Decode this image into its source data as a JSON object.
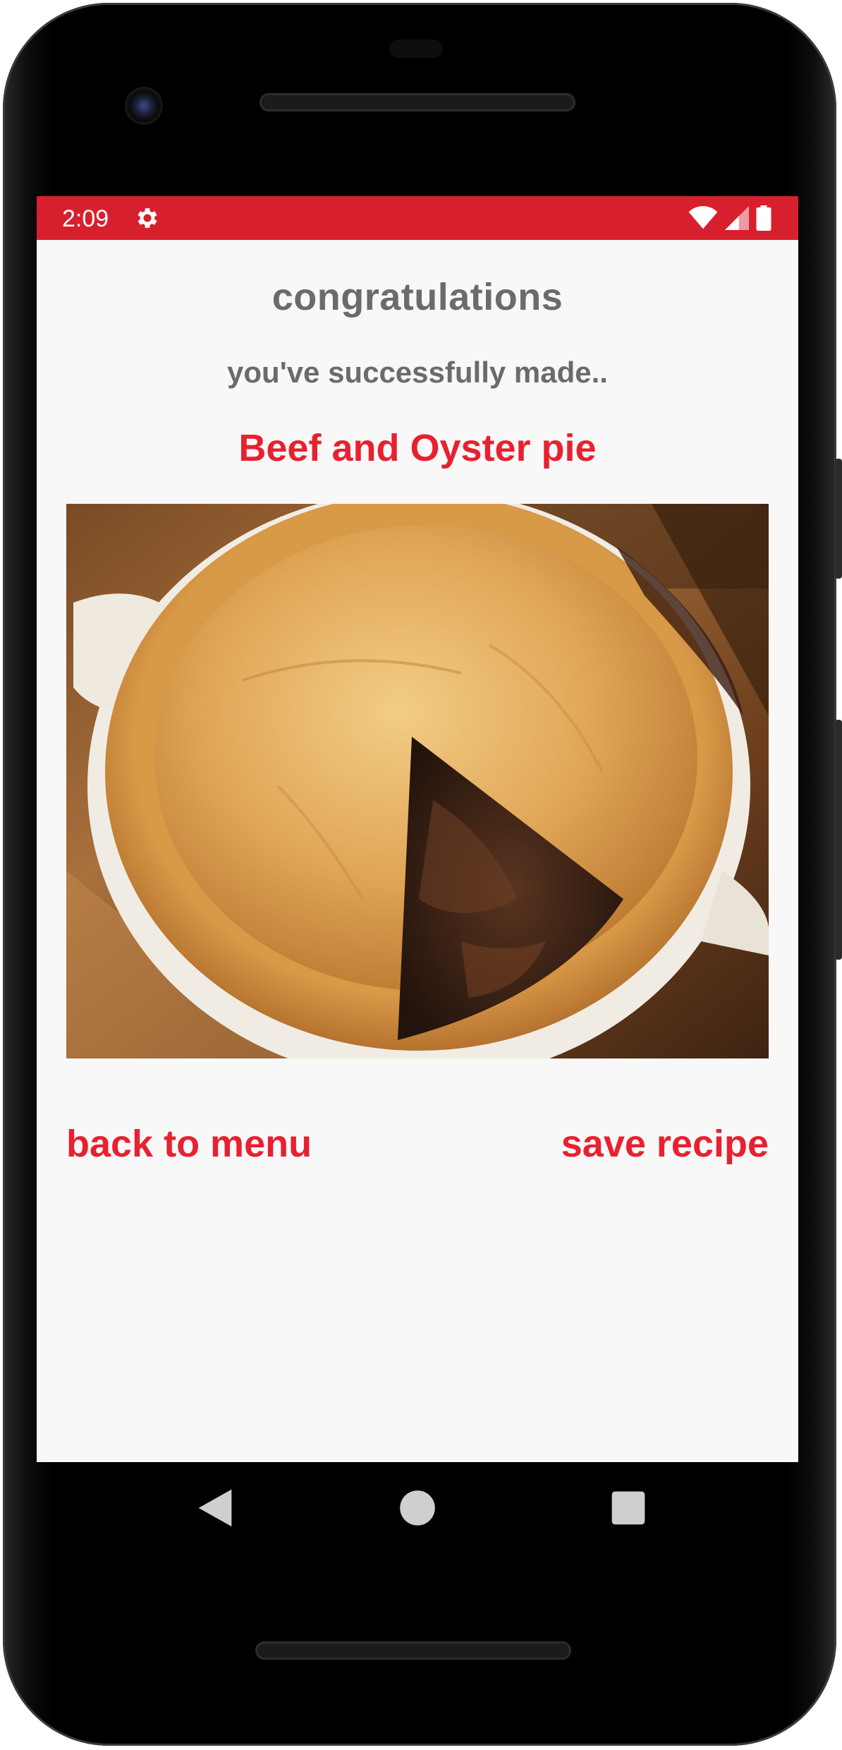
{
  "status_bar": {
    "time": "2:09",
    "color": "#d81f2d",
    "icons": [
      "gear-icon",
      "wifi-icon",
      "signal-icon",
      "battery-icon"
    ]
  },
  "screen": {
    "title": "congratulations",
    "subtitle": "you've successfully made..",
    "recipe_name": "Beef and Oyster pie",
    "accent_color": "#e8202f",
    "text_color": "#6b6b6b"
  },
  "actions": {
    "back_label": "back to menu",
    "save_label": "save recipe"
  },
  "navigation": {
    "icons": [
      "back-triangle-icon",
      "home-circle-icon",
      "recents-square-icon"
    ]
  }
}
